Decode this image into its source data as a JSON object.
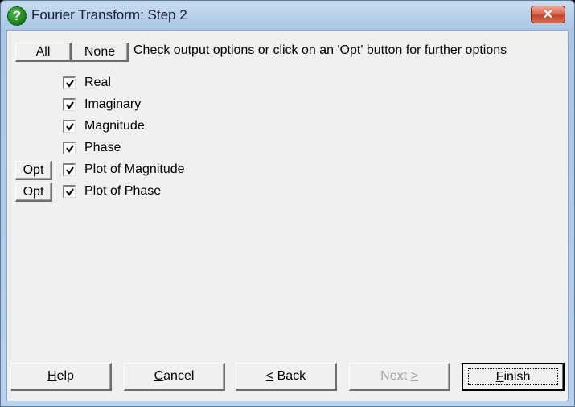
{
  "window": {
    "title": "Fourier Transform: Step 2",
    "icon": "help-question-icon",
    "close_label": "✕"
  },
  "toolbar": {
    "all_label": "All",
    "none_label": "None",
    "instructions": "Check output options or click on an 'Opt' button for further options"
  },
  "options": [
    {
      "label": "Real",
      "checked": true,
      "has_opt": false
    },
    {
      "label": "Imaginary",
      "checked": true,
      "has_opt": false
    },
    {
      "label": "Magnitude",
      "checked": true,
      "has_opt": false
    },
    {
      "label": "Phase",
      "checked": true,
      "has_opt": false
    },
    {
      "label": "Plot of Magnitude",
      "checked": true,
      "has_opt": true,
      "opt_label": "Opt"
    },
    {
      "label": "Plot of Phase",
      "checked": true,
      "has_opt": true,
      "opt_label": "Opt"
    }
  ],
  "footer": {
    "help": {
      "label": "Help",
      "mnemonic": "H",
      "rest": "elp",
      "enabled": true
    },
    "cancel": {
      "label": "Cancel",
      "mnemonic": "C",
      "rest": "ancel",
      "enabled": true
    },
    "back": {
      "label": "< Back",
      "mnemonic": "<",
      "rest": " Back",
      "enabled": true
    },
    "next": {
      "label": "Next >",
      "prefix": "Next ",
      "mnemonic": ">",
      "enabled": false
    },
    "finish": {
      "label": "Finish",
      "mnemonic": "F",
      "rest": "inish",
      "enabled": true,
      "default": true
    }
  }
}
